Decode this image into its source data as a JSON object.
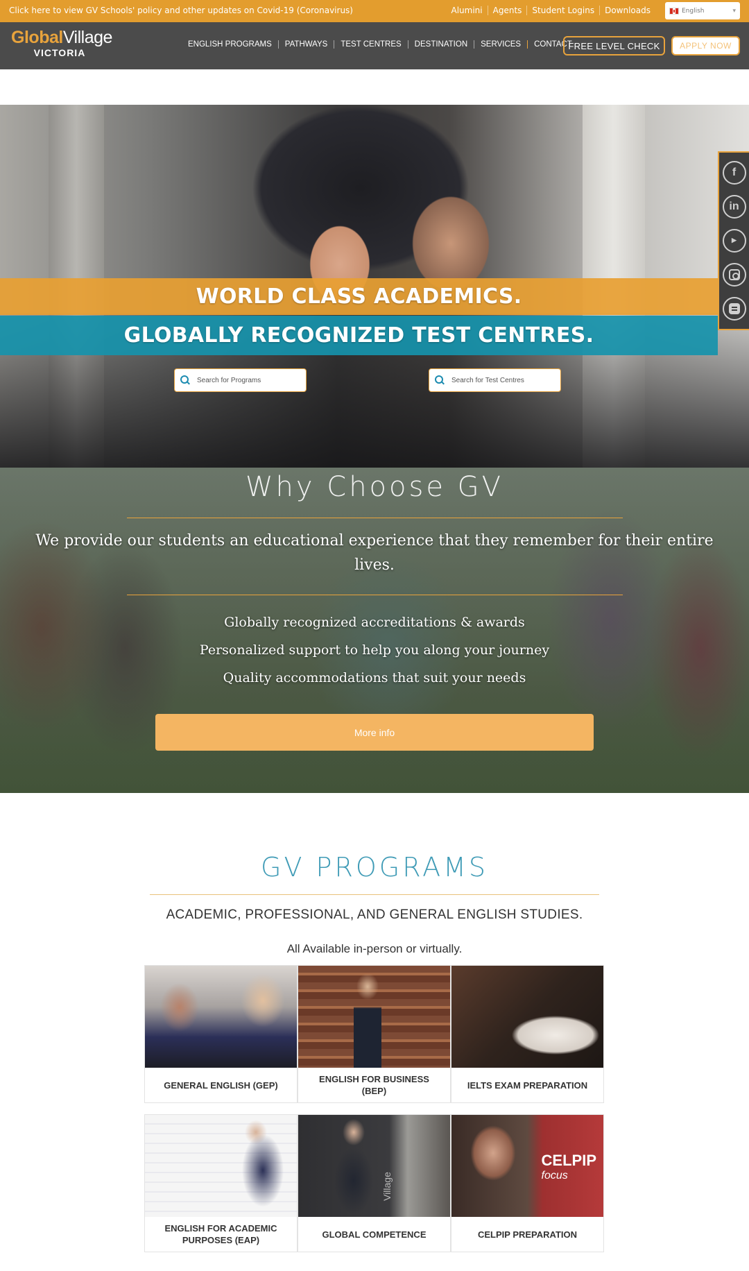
{
  "topbar": {
    "notice": "Click here to view GV Schools' policy and other updates on Covid-19 (Coronavirus)",
    "links": [
      "Alumini",
      "Agents",
      "Student Logins",
      "Downloads"
    ],
    "language": "English"
  },
  "nav": {
    "logo_part1": "Gl",
    "logo_part2": "bal",
    "logo_part3": "Village",
    "logo_sub": "VICTORIA",
    "items": [
      "ENGLISH PROGRAMS",
      "PATHWAYS",
      "TEST CENTRES",
      "DESTINATION",
      "SERVICES",
      "CONTACT"
    ],
    "level_check": "FREE LEVEL CHECK",
    "apply": "APPLY NOW"
  },
  "hero": {
    "line1": "WORLD CLASS ACADEMICS.",
    "line2": "GLOBALLY RECOGNIZED TEST CENTRES.",
    "search_programs": "Search for Programs",
    "search_tests": "Search for Test Centres"
  },
  "social": [
    "facebook-icon",
    "linkedin-icon",
    "youtube-icon",
    "instagram-icon",
    "blogger-icon"
  ],
  "why": {
    "title": "Why Choose GV",
    "lead": "We provide our students an educational experience that they remember for their entire lives.",
    "points": [
      "Globally recognized accreditations & awards",
      "Personalized support to help you along your journey",
      "Quality accommodations that suit your needs"
    ],
    "button": "More info"
  },
  "programs": {
    "title": "GV PROGRAMS",
    "subtitle": "ACADEMIC, PROFESSIONAL, AND GENERAL ENGLISH STUDIES.",
    "availability": "All Available in-person or virtually.",
    "cards": [
      "GENERAL ENGLISH (GEP)",
      "ENGLISH FOR BUSINESS (BEP)",
      "IELTS EXAM PREPARATION",
      "ENGLISH FOR ACADEMIC PURPOSES (EAP)",
      "GLOBAL COMPETENCE",
      "CELPIP PREPARATION"
    ],
    "celpip_word": "CELPIP",
    "celpip_focus": "focus",
    "gv_book": "Village"
  },
  "colors": {
    "accent": "#e39d2e",
    "teal": "#1692ab",
    "nav_bg": "#4b4b4b"
  }
}
